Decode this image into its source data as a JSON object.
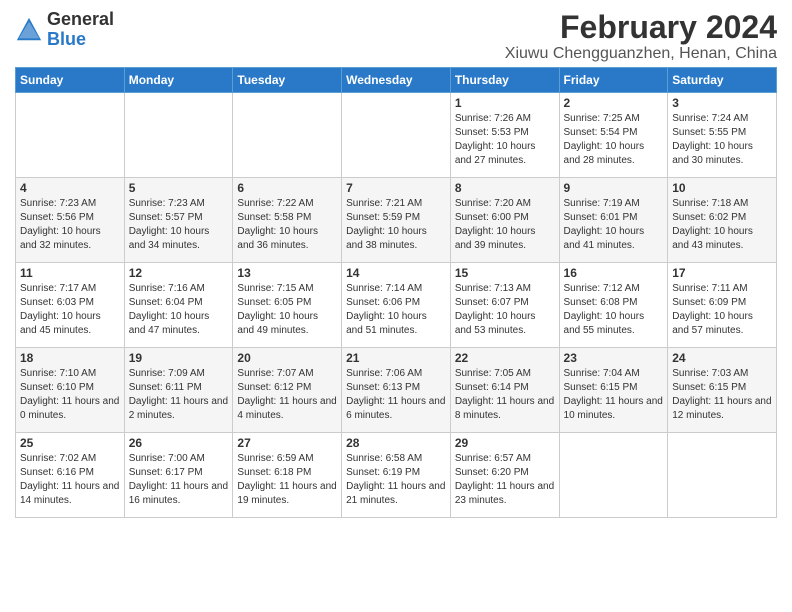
{
  "logo": {
    "general": "General",
    "blue": "Blue"
  },
  "header": {
    "title": "February 2024",
    "subtitle": "Xiuwu Chengguanzhen, Henan, China"
  },
  "weekdays": [
    "Sunday",
    "Monday",
    "Tuesday",
    "Wednesday",
    "Thursday",
    "Friday",
    "Saturday"
  ],
  "weeks": [
    [
      {
        "day": "",
        "content": ""
      },
      {
        "day": "",
        "content": ""
      },
      {
        "day": "",
        "content": ""
      },
      {
        "day": "",
        "content": ""
      },
      {
        "day": "1",
        "content": "Sunrise: 7:26 AM\nSunset: 5:53 PM\nDaylight: 10 hours and 27 minutes."
      },
      {
        "day": "2",
        "content": "Sunrise: 7:25 AM\nSunset: 5:54 PM\nDaylight: 10 hours and 28 minutes."
      },
      {
        "day": "3",
        "content": "Sunrise: 7:24 AM\nSunset: 5:55 PM\nDaylight: 10 hours and 30 minutes."
      }
    ],
    [
      {
        "day": "4",
        "content": "Sunrise: 7:23 AM\nSunset: 5:56 PM\nDaylight: 10 hours and 32 minutes."
      },
      {
        "day": "5",
        "content": "Sunrise: 7:23 AM\nSunset: 5:57 PM\nDaylight: 10 hours and 34 minutes."
      },
      {
        "day": "6",
        "content": "Sunrise: 7:22 AM\nSunset: 5:58 PM\nDaylight: 10 hours and 36 minutes."
      },
      {
        "day": "7",
        "content": "Sunrise: 7:21 AM\nSunset: 5:59 PM\nDaylight: 10 hours and 38 minutes."
      },
      {
        "day": "8",
        "content": "Sunrise: 7:20 AM\nSunset: 6:00 PM\nDaylight: 10 hours and 39 minutes."
      },
      {
        "day": "9",
        "content": "Sunrise: 7:19 AM\nSunset: 6:01 PM\nDaylight: 10 hours and 41 minutes."
      },
      {
        "day": "10",
        "content": "Sunrise: 7:18 AM\nSunset: 6:02 PM\nDaylight: 10 hours and 43 minutes."
      }
    ],
    [
      {
        "day": "11",
        "content": "Sunrise: 7:17 AM\nSunset: 6:03 PM\nDaylight: 10 hours and 45 minutes."
      },
      {
        "day": "12",
        "content": "Sunrise: 7:16 AM\nSunset: 6:04 PM\nDaylight: 10 hours and 47 minutes."
      },
      {
        "day": "13",
        "content": "Sunrise: 7:15 AM\nSunset: 6:05 PM\nDaylight: 10 hours and 49 minutes."
      },
      {
        "day": "14",
        "content": "Sunrise: 7:14 AM\nSunset: 6:06 PM\nDaylight: 10 hours and 51 minutes."
      },
      {
        "day": "15",
        "content": "Sunrise: 7:13 AM\nSunset: 6:07 PM\nDaylight: 10 hours and 53 minutes."
      },
      {
        "day": "16",
        "content": "Sunrise: 7:12 AM\nSunset: 6:08 PM\nDaylight: 10 hours and 55 minutes."
      },
      {
        "day": "17",
        "content": "Sunrise: 7:11 AM\nSunset: 6:09 PM\nDaylight: 10 hours and 57 minutes."
      }
    ],
    [
      {
        "day": "18",
        "content": "Sunrise: 7:10 AM\nSunset: 6:10 PM\nDaylight: 11 hours and 0 minutes."
      },
      {
        "day": "19",
        "content": "Sunrise: 7:09 AM\nSunset: 6:11 PM\nDaylight: 11 hours and 2 minutes."
      },
      {
        "day": "20",
        "content": "Sunrise: 7:07 AM\nSunset: 6:12 PM\nDaylight: 11 hours and 4 minutes."
      },
      {
        "day": "21",
        "content": "Sunrise: 7:06 AM\nSunset: 6:13 PM\nDaylight: 11 hours and 6 minutes."
      },
      {
        "day": "22",
        "content": "Sunrise: 7:05 AM\nSunset: 6:14 PM\nDaylight: 11 hours and 8 minutes."
      },
      {
        "day": "23",
        "content": "Sunrise: 7:04 AM\nSunset: 6:15 PM\nDaylight: 11 hours and 10 minutes."
      },
      {
        "day": "24",
        "content": "Sunrise: 7:03 AM\nSunset: 6:15 PM\nDaylight: 11 hours and 12 minutes."
      }
    ],
    [
      {
        "day": "25",
        "content": "Sunrise: 7:02 AM\nSunset: 6:16 PM\nDaylight: 11 hours and 14 minutes."
      },
      {
        "day": "26",
        "content": "Sunrise: 7:00 AM\nSunset: 6:17 PM\nDaylight: 11 hours and 16 minutes."
      },
      {
        "day": "27",
        "content": "Sunrise: 6:59 AM\nSunset: 6:18 PM\nDaylight: 11 hours and 19 minutes."
      },
      {
        "day": "28",
        "content": "Sunrise: 6:58 AM\nSunset: 6:19 PM\nDaylight: 11 hours and 21 minutes."
      },
      {
        "day": "29",
        "content": "Sunrise: 6:57 AM\nSunset: 6:20 PM\nDaylight: 11 hours and 23 minutes."
      },
      {
        "day": "",
        "content": ""
      },
      {
        "day": "",
        "content": ""
      }
    ]
  ]
}
